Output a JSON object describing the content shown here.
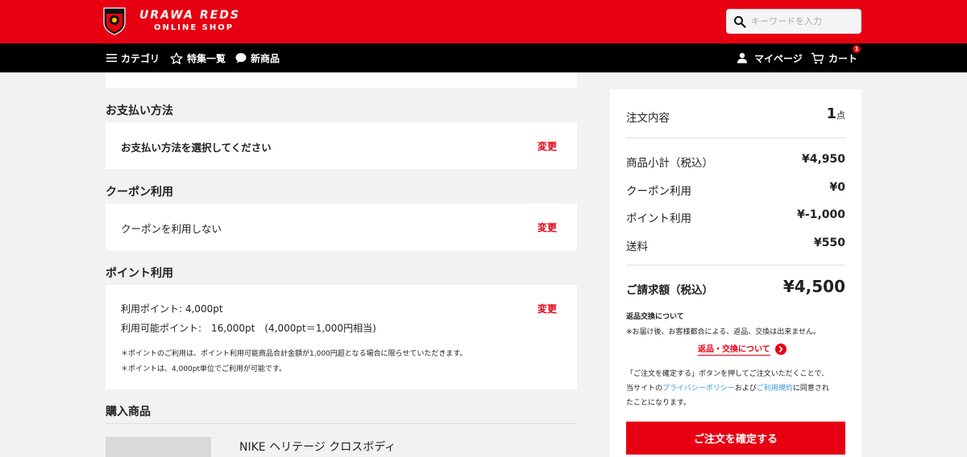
{
  "header": {
    "logo_line1": "URAWA REDS",
    "logo_line2": "ONLINE SHOP",
    "search_placeholder": "キーワードを入力"
  },
  "nav": {
    "category": "カテゴリ",
    "features": "特集一覧",
    "new_items": "新商品",
    "mypage": "マイページ",
    "cart": "カート",
    "cart_count": "1"
  },
  "payment": {
    "title": "お支払い方法",
    "message": "お支払い方法を選択してください",
    "change": "変更"
  },
  "coupon": {
    "title": "クーポン利用",
    "message": "クーポンを利用しない",
    "change": "変更"
  },
  "points": {
    "title": "ポイント利用",
    "use_line": "利用ポイント: 4,000pt",
    "available_line": "利用可能ポイント:　16,000pt　(4,000pt＝1,000円相当)",
    "note1": "＊ポイントのご利用は、ポイント利用可能商品合計金額が1,000円超となる場合に限らせていただきます。",
    "note2": "＊ポイントは、4,000pt単位でご利用が可能です。",
    "change": "変更"
  },
  "purchase": {
    "title": "購入商品",
    "product_name": "NIKE ヘリテージ クロスボディ"
  },
  "summary": {
    "order_label": "注文内容",
    "order_count": "1",
    "order_unit": "点",
    "subtotal_label": "商品小計（税込）",
    "subtotal_value": "¥4,950",
    "coupon_label": "クーポン利用",
    "coupon_value": "¥0",
    "point_label": "ポイント利用",
    "point_value": "¥-1,000",
    "shipping_label": "送料",
    "shipping_value": "¥550",
    "total_label": "ご請求額（税込）",
    "total_value": "¥4,500",
    "return_title": "返品交換について",
    "return_note": "※お届け後、お客様都合による、返品、交換は出来ません。",
    "return_link": "返品・交換について",
    "agree_line1": "「ご注文を確定する」ボタンを押してご注文いただくことで、",
    "agree_line2_pre": "当サイトの",
    "privacy_link": "プライバシーポリシー",
    "agree_line2_mid": "および",
    "terms_link": "ご利用規約",
    "agree_line2_post": "に同意され",
    "agree_line3": "たことになります。",
    "confirm_button": "ご注文を確定する"
  },
  "colors": {
    "brand_red": "#e60012",
    "link_blue": "#3a9ad9",
    "nav_black": "#000000"
  }
}
